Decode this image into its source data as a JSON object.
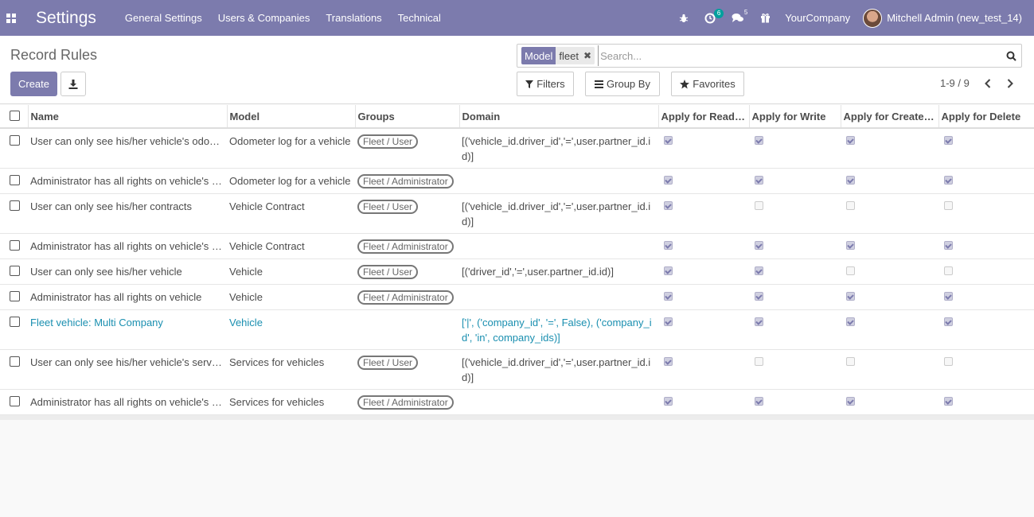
{
  "navbar": {
    "app_title": "Settings",
    "menu": [
      "General Settings",
      "Users & Companies",
      "Translations",
      "Technical"
    ],
    "activity_count": "6",
    "messages_count": "5",
    "company": "YourCompany",
    "user": "Mitchell Admin (new_test_14)"
  },
  "control_panel": {
    "breadcrumb": "Record Rules",
    "create_label": "Create",
    "search": {
      "facet_label": "Model",
      "facet_value": "fleet",
      "placeholder": "Search..."
    },
    "filters_label": "Filters",
    "groupby_label": "Group By",
    "favorites_label": "Favorites",
    "pager": "1-9 / 9"
  },
  "table": {
    "columns": [
      "Name",
      "Model",
      "Groups",
      "Domain",
      "Apply for Read…",
      "Apply for Write",
      "Apply for Create…",
      "Apply for Delete"
    ],
    "rows": [
      {
        "name": "User can only see his/her vehicle's odo…",
        "model": "Odometer log for a vehicle",
        "group": "Fleet / User",
        "domain": "[('vehicle_id.driver_id','=',user.partner_id.id)]",
        "read": true,
        "write": true,
        "create": true,
        "delete": true
      },
      {
        "name": "Administrator has all rights on vehicle's …",
        "model": "Odometer log for a vehicle",
        "group": "Fleet / Administrator",
        "domain": "",
        "read": true,
        "write": true,
        "create": true,
        "delete": true
      },
      {
        "name": "User can only see his/her contracts",
        "model": "Vehicle Contract",
        "group": "Fleet / User",
        "domain": "[('vehicle_id.driver_id','=',user.partner_id.id)]",
        "read": true,
        "write": false,
        "create": false,
        "delete": false
      },
      {
        "name": "Administrator has all rights on vehicle's …",
        "model": "Vehicle Contract",
        "group": "Fleet / Administrator",
        "domain": "",
        "read": true,
        "write": true,
        "create": true,
        "delete": true
      },
      {
        "name": "User can only see his/her vehicle",
        "model": "Vehicle",
        "group": "Fleet / User",
        "domain": "[('driver_id','=',user.partner_id.id)]",
        "read": true,
        "write": true,
        "create": false,
        "delete": false
      },
      {
        "name": "Administrator has all rights on vehicle",
        "model": "Vehicle",
        "group": "Fleet / Administrator",
        "domain": "",
        "read": true,
        "write": true,
        "create": true,
        "delete": true
      },
      {
        "name": "Fleet vehicle: Multi Company",
        "model": "Vehicle",
        "group": "",
        "domain": "['|', ('company_id', '=', False), ('company_id', 'in', company_ids)]",
        "read": true,
        "write": true,
        "create": true,
        "delete": true,
        "highlight": true
      },
      {
        "name": "User can only see his/her vehicle's serv…",
        "model": "Services for vehicles",
        "group": "Fleet / User",
        "domain": "[('vehicle_id.driver_id','=',user.partner_id.id)]",
        "read": true,
        "write": false,
        "create": false,
        "delete": false
      },
      {
        "name": "Administrator has all rights on vehicle's …",
        "model": "Services for vehicles",
        "group": "Fleet / Administrator",
        "domain": "",
        "read": true,
        "write": true,
        "create": true,
        "delete": true
      }
    ]
  },
  "colors": {
    "brand": "#7c7bad",
    "badge": "#00a09d",
    "link": "#1a8fb0"
  },
  "icons": [
    "apps-grid-icon",
    "bug-icon",
    "activity-clock-icon",
    "chat-icon",
    "gift-icon",
    "download-icon",
    "close-icon",
    "search-icon",
    "filter-icon",
    "list-icon",
    "star-icon",
    "chevron-left-icon",
    "chevron-right-icon"
  ]
}
